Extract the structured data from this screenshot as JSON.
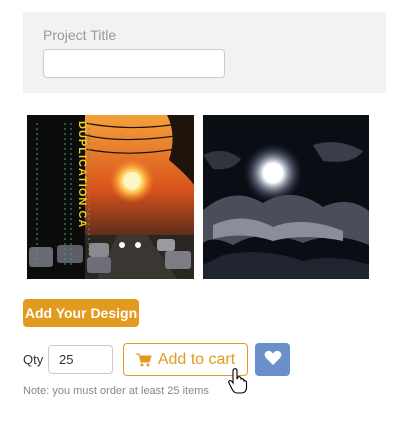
{
  "project": {
    "title_label": "Project Title",
    "title_value": "",
    "title_placeholder": ""
  },
  "covers": {
    "left_spine_text": "DUPLICATION.CA",
    "left_icon": "sunset-street-cover-image",
    "right_icon": "moon-clouds-cover-image"
  },
  "actions": {
    "add_design_label": "Add Your Design",
    "qty_label": "Qty",
    "qty_value": "25",
    "add_to_cart_label": "Add to cart",
    "cart_icon": "cart-icon",
    "wishlist_icon": "heart-icon",
    "note": "Note: you must order at least 25 items"
  },
  "colors": {
    "accent": "#e39b1f",
    "wishlist_blue": "#6b8fc9",
    "panel_bg": "#f2f2f2"
  }
}
